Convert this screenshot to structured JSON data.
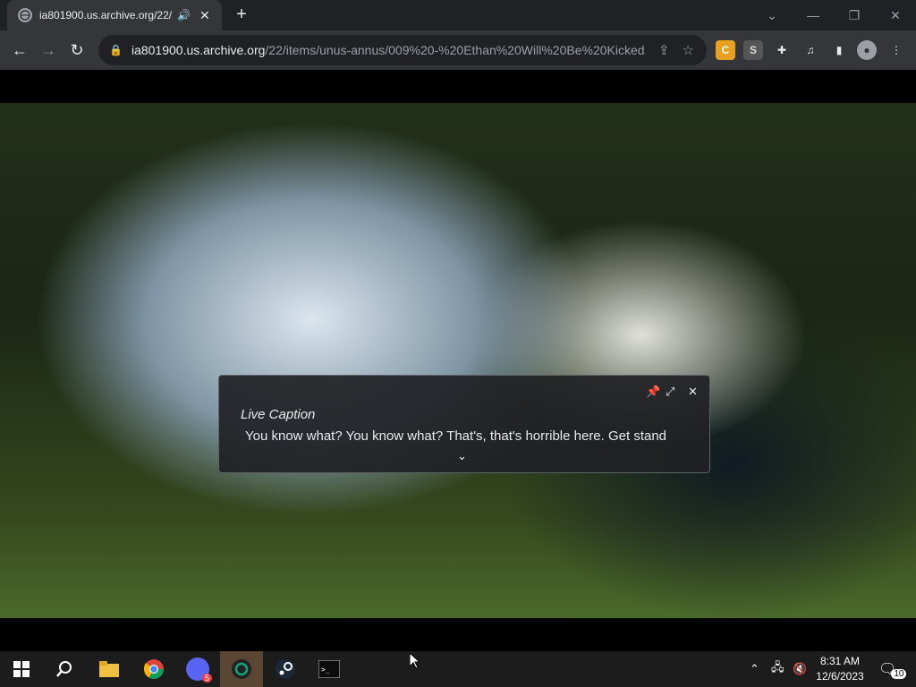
{
  "browser": {
    "tab_title": "ia801900.us.archive.org/22/i",
    "url_host": "ia801900.us.archive.org",
    "url_path": "/22/items/unus-annus/009%20-%20Ethan%20Will%20Be%20Kicked..."
  },
  "caption": {
    "title": "Live Caption",
    "text": "You know what? You know what? That's, that's horrible here. Get stand"
  },
  "taskbar": {
    "time": "8:31 AM",
    "date": "12/6/2023",
    "notification_count": "10",
    "discord_badge": "5"
  },
  "colors": {
    "tab_bg": "#35363a",
    "toolbar_bg": "#35363a",
    "taskbar_bg": "#1c1c1c",
    "active_taskbar_item": "#5a4632",
    "caption_bg": "#202124"
  }
}
